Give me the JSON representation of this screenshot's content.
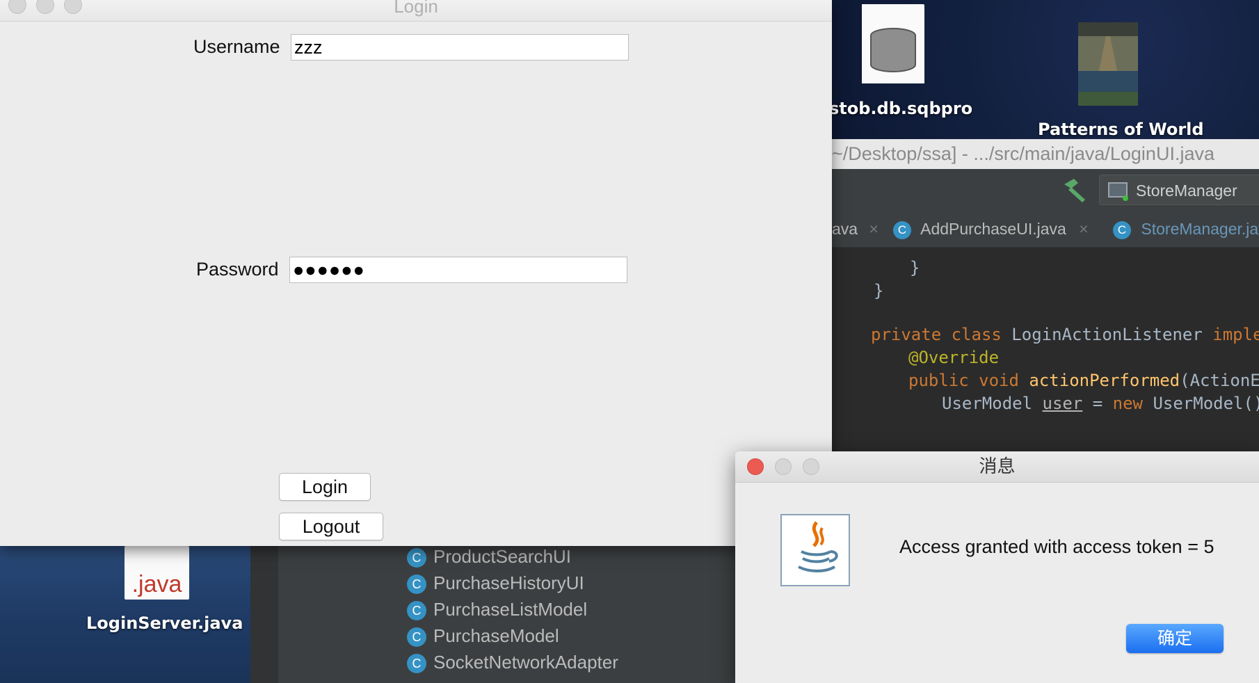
{
  "desktop": {
    "icons": [
      {
        "label": "stob.db.sqbpro",
        "kind": "database-file-icon"
      },
      {
        "label": "Patterns of World",
        "kind": "book-cover-icon"
      },
      {
        "label": "LoginServer.java",
        "kind": "java-file-icon",
        "badge": ".java"
      }
    ]
  },
  "ide": {
    "title": "~/Desktop/ssa] - .../src/main/java/LoginUI.java",
    "run_config": "StoreManager",
    "tabs": [
      {
        "label": "ava"
      },
      {
        "label": "AddPurchaseUI.java"
      },
      {
        "label": "StoreManager.jav"
      }
    ],
    "code": [
      "}",
      "}",
      "private class LoginActionListener implem",
      "@Override",
      "public void actionPerformed(ActionEv",
      "UserModel user = new UserModel()"
    ],
    "tree_items": [
      "ProductSearchUI",
      "PurchaseHistoryUI",
      "PurchaseListModel",
      "PurchaseModel",
      "SocketNetworkAdapter"
    ]
  },
  "login_window": {
    "title": "Login",
    "username_label": "Username",
    "username_value": "zzz",
    "password_label": "Password",
    "password_value": "●●●●●●",
    "login_button": "Login",
    "logout_button": "Logout"
  },
  "dialog": {
    "title": "消息",
    "message": "Access granted with access token = 5",
    "ok_button": "确定"
  },
  "colors": {
    "ide_bg": "#2b2b2b",
    "keyword": "#cc7832",
    "annotation": "#bbb529",
    "function": "#ffc66d",
    "ok_button": "#1a6ff0",
    "close_red": "#ec5b52"
  }
}
